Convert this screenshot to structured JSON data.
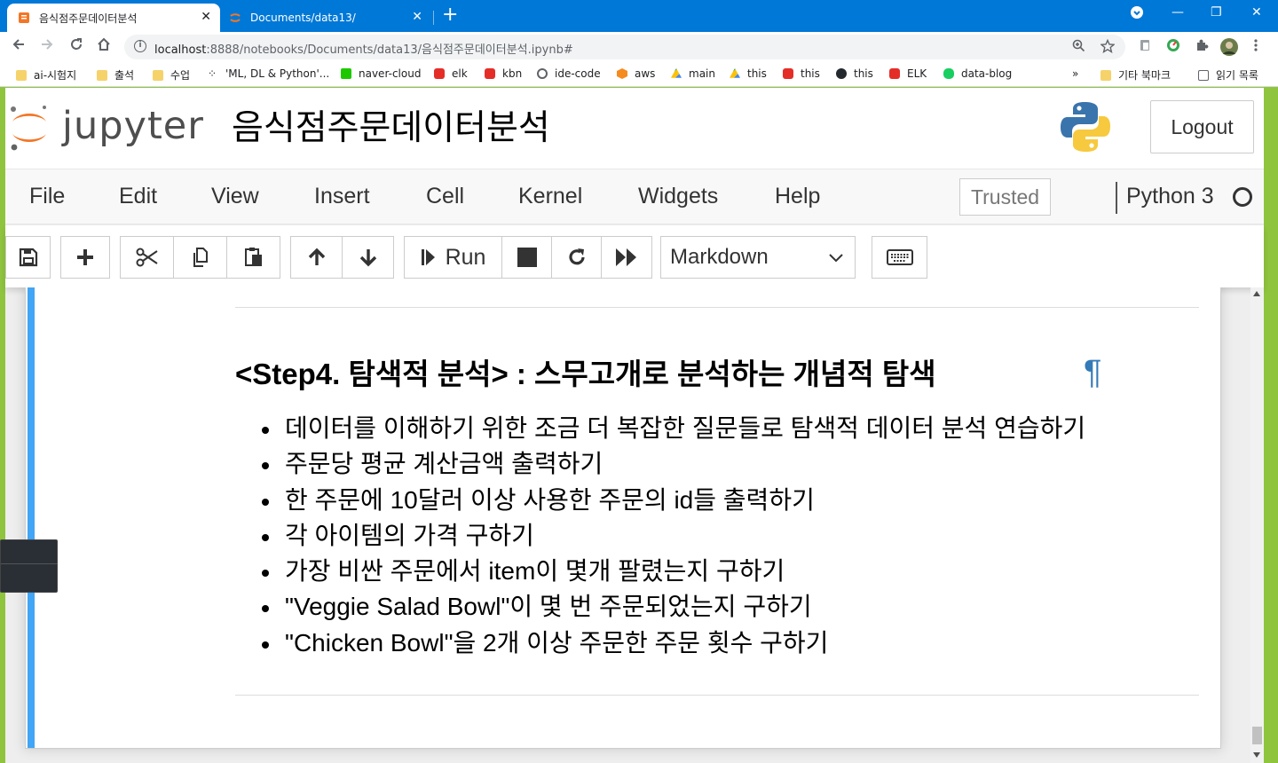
{
  "browser": {
    "tabs": [
      {
        "title": "음식점주문데이터분석",
        "close": "✕"
      },
      {
        "title": "Documents/data13/",
        "close": "✕"
      }
    ],
    "new_tab": "+",
    "window_controls": {
      "minimize": "—",
      "restore": "❐",
      "close": "✕"
    },
    "url": {
      "host": "localhost",
      "rest": ":8888/notebooks/Documents/data13/음식점주문데이터분석.ipynb#"
    },
    "bookmarks": [
      {
        "label": "ai-시험지",
        "icon": "folder-icon"
      },
      {
        "label": "출석",
        "icon": "folder-icon"
      },
      {
        "label": "수업",
        "icon": "folder-icon"
      },
      {
        "label": "'ML, DL & Python'...",
        "icon": "dots-icon"
      },
      {
        "label": "naver-cloud",
        "icon": "naver-cloud-icon"
      },
      {
        "label": "elk",
        "icon": "youtube-icon"
      },
      {
        "label": "kbn",
        "icon": "youtube-icon"
      },
      {
        "label": "ide-code",
        "icon": "ide-icon"
      },
      {
        "label": "aws",
        "icon": "aws-icon"
      },
      {
        "label": "main",
        "icon": "drive-icon"
      },
      {
        "label": "this",
        "icon": "drive-icon"
      },
      {
        "label": "this",
        "icon": "youtube-icon"
      },
      {
        "label": "this",
        "icon": "github-icon"
      },
      {
        "label": "ELK",
        "icon": "youtube-icon"
      },
      {
        "label": "data-blog",
        "icon": "blog-icon"
      }
    ],
    "bookmarks_overflow": "»",
    "other_bookmarks": "기타 북마크",
    "reading_list": "읽기 목록"
  },
  "jupyter": {
    "logo_text": "jupyter",
    "notebook_name": "음식점주문데이터분석",
    "logout": "Logout",
    "menus": [
      "File",
      "Edit",
      "View",
      "Insert",
      "Cell",
      "Kernel",
      "Widgets",
      "Help"
    ],
    "trusted": "Trusted",
    "kernel_name": "Python 3",
    "toolbar": {
      "run_label": "Run",
      "cell_type": "Markdown"
    }
  },
  "cell": {
    "heading": "<Step4. 탐색적 분석> : 스무고개로 분석하는 개념적 탐색",
    "anchor": "¶",
    "bullets": [
      "데이터를 이해하기 위한 조금 더 복잡한 질문들로 탐색적 데이터 분석 연습하기",
      "주문당 평균 계산금액 출력하기",
      "한 주문에 10달러 이상 사용한 주문의 id들 출력하기",
      "각 아이템의 가격 구하기",
      "가장 비싼 주문에서 item이 몇개 팔렸는지 구하기",
      "\"Veggie Salad Bowl\"이 몇 번 주문되었는지 구하기",
      "\"Chicken Bowl\"을 2개 이상 주문한 주문 횟수 구하기"
    ]
  },
  "colors": {
    "tabbar": "#0078d7",
    "cell_selected_bar": "#42a5f5",
    "anchor": "#337ab7",
    "desktop": "#8fc43e"
  }
}
